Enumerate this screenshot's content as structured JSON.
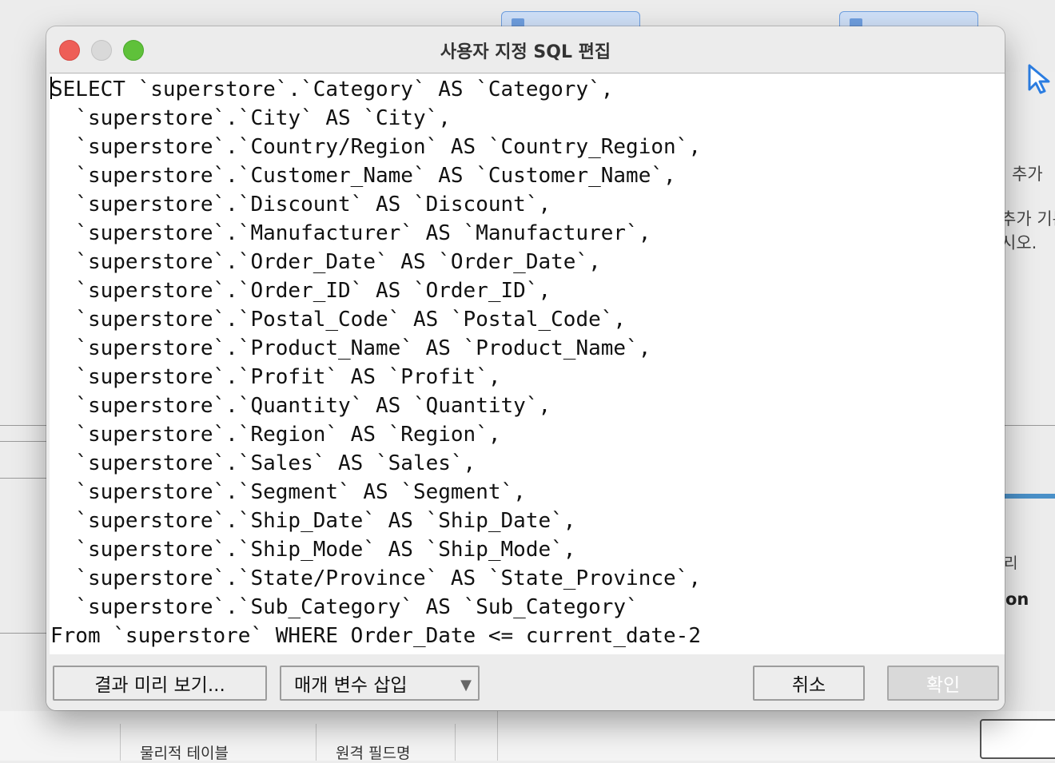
{
  "background": {
    "right_texts": [
      "추가",
      "추가 기본",
      "시오.",
      "리",
      "on"
    ],
    "column_headers": [
      "물리적 테이블",
      "원격 필드명"
    ]
  },
  "dialog": {
    "title": "사용자 지정 SQL 편집",
    "sql_lines": [
      "SELECT `superstore`.`Category` AS `Category`,",
      "  `superstore`.`City` AS `City`,",
      "  `superstore`.`Country/Region` AS `Country_Region`,",
      "  `superstore`.`Customer_Name` AS `Customer_Name`,",
      "  `superstore`.`Discount` AS `Discount`,",
      "  `superstore`.`Manufacturer` AS `Manufacturer`,",
      "  `superstore`.`Order_Date` AS `Order_Date`,",
      "  `superstore`.`Order_ID` AS `Order_ID`,",
      "  `superstore`.`Postal_Code` AS `Postal_Code`,",
      "  `superstore`.`Product_Name` AS `Product_Name`,",
      "  `superstore`.`Profit` AS `Profit`,",
      "  `superstore`.`Quantity` AS `Quantity`,",
      "  `superstore`.`Region` AS `Region`,",
      "  `superstore`.`Sales` AS `Sales`,",
      "  `superstore`.`Segment` AS `Segment`,",
      "  `superstore`.`Ship_Date` AS `Ship_Date`,",
      "  `superstore`.`Ship_Mode` AS `Ship_Mode`,",
      "  `superstore`.`State/Province` AS `State_Province`,",
      "  `superstore`.`Sub_Category` AS `Sub_Category`",
      "From `superstore` WHERE Order_Date <= current_date-2"
    ],
    "buttons": {
      "preview": "결과 미리 보기...",
      "insert_parameter": "매개 변수 삽입",
      "cancel": "취소",
      "ok": "확인"
    }
  }
}
